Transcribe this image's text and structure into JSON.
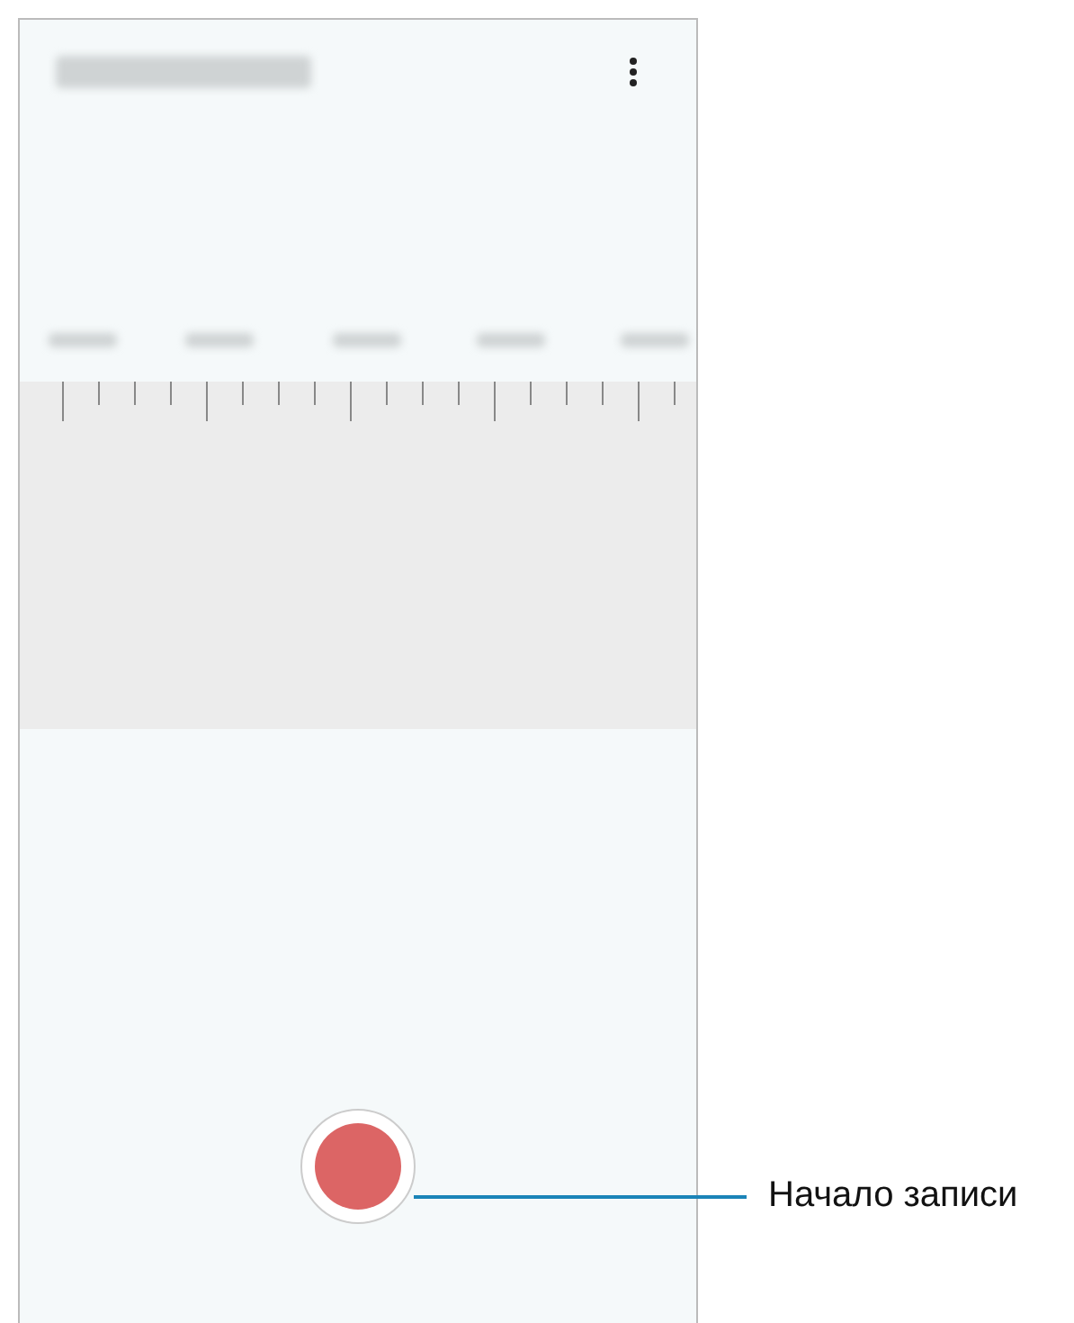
{
  "callout": {
    "label": "Начало записи"
  }
}
